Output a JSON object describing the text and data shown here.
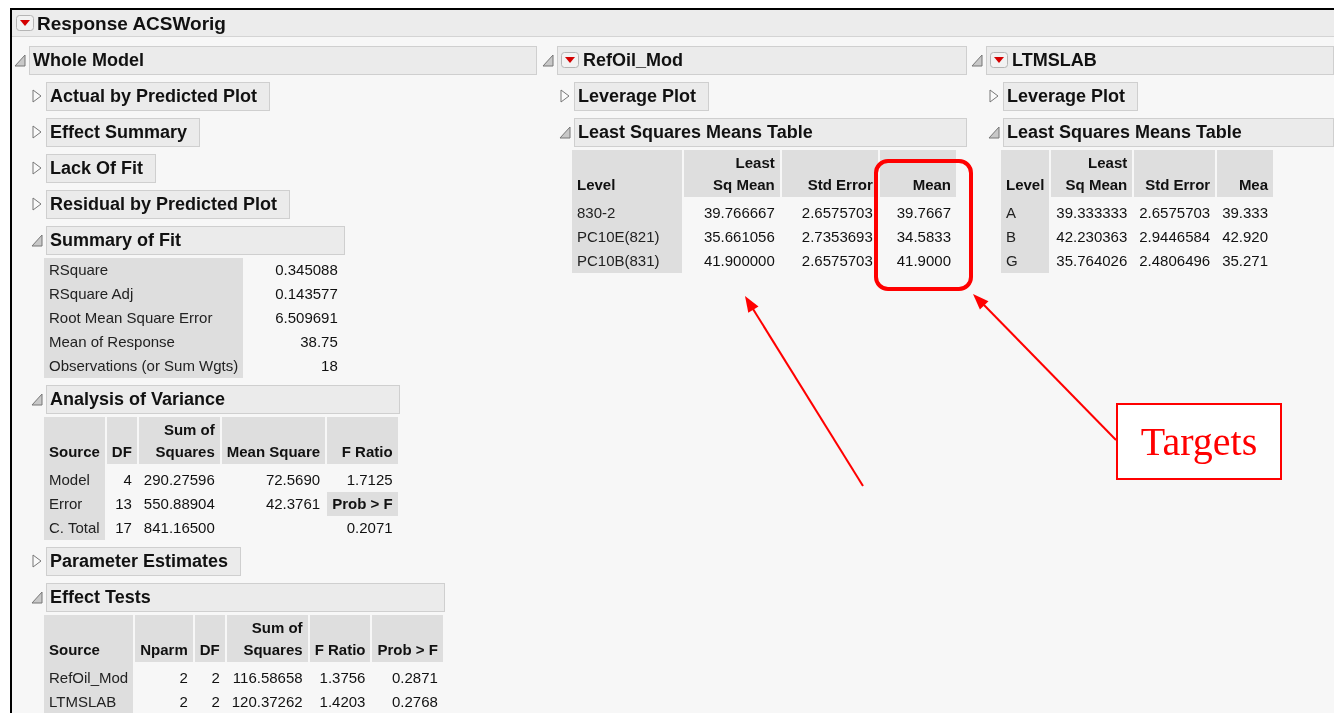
{
  "report": {
    "title": "Response ACSWorig",
    "has_menu": true
  },
  "columns": [
    {
      "title": "Whole Model",
      "expanded": true,
      "has_menu": false,
      "sections": [
        {
          "title": "Actual by Predicted Plot",
          "expanded": false
        },
        {
          "title": "Effect Summary",
          "expanded": false
        },
        {
          "title": "Lack Of Fit",
          "expanded": false
        },
        {
          "title": "Residual by Predicted Plot",
          "expanded": false
        },
        {
          "title": "Summary of Fit",
          "expanded": true,
          "table": {
            "kind": "pairs",
            "rows": [
              [
                "RSquare",
                "0.345088"
              ],
              [
                "RSquare Adj",
                "0.143577"
              ],
              [
                "Root Mean Square Error",
                "6.509691"
              ],
              [
                "Mean of Response",
                "38.75"
              ],
              [
                "Observations (or Sum Wgts)",
                "18"
              ]
            ]
          }
        },
        {
          "title": "Analysis of Variance",
          "expanded": true,
          "table": {
            "kind": "grid",
            "columns": [
              "Source",
              "DF",
              "Sum of\nSquares",
              "Mean Square",
              "F Ratio"
            ],
            "rows": [
              [
                "Model",
                "4",
                "290.27596",
                "72.5690",
                "1.7125"
              ],
              [
                "Error",
                "13",
                "550.88904",
                "42.3761",
                {
                  "text": "Prob > F",
                  "kind": "label"
                }
              ],
              [
                "C. Total",
                "17",
                "841.16500",
                null,
                "0.2071"
              ]
            ]
          }
        },
        {
          "title": "Parameter Estimates",
          "expanded": false
        },
        {
          "title": "Effect Tests",
          "expanded": true,
          "table": {
            "kind": "grid",
            "columns": [
              "Source",
              "Nparm",
              "DF",
              "Sum of\nSquares",
              "F Ratio",
              "Prob > F"
            ],
            "rows": [
              [
                "RefOil_Mod",
                "2",
                "2",
                "116.58658",
                "1.3756",
                "0.2871"
              ],
              [
                "LTMSLAB",
                "2",
                "2",
                "120.37262",
                "1.4203",
                "0.2768"
              ]
            ]
          }
        }
      ]
    },
    {
      "title": "RefOil_Mod",
      "expanded": true,
      "has_menu": true,
      "sections": [
        {
          "title": "Leverage Plot",
          "expanded": false
        },
        {
          "title": "Least Squares Means Table",
          "expanded": true,
          "table": {
            "kind": "grid",
            "columns": [
              "Level",
              "Least\nSq Mean",
              "Std Error",
              "Mean"
            ],
            "rows": [
              [
                "830-2",
                "39.766667",
                "2.6575703",
                "39.7667"
              ],
              [
                "PC10E(821)",
                "35.661056",
                "2.7353693",
                "34.5833"
              ],
              [
                "PC10B(831)",
                "41.900000",
                "2.6575703",
                "41.9000"
              ]
            ]
          }
        }
      ]
    },
    {
      "title": "LTMSLAB",
      "expanded": true,
      "has_menu": true,
      "sections": [
        {
          "title": "Leverage Plot",
          "expanded": false
        },
        {
          "title": "Least Squares Means Table",
          "expanded": true,
          "table": {
            "kind": "grid",
            "columns": [
              "Level",
              "Least\nSq Mean",
              "Std Error",
              "Mea"
            ],
            "rows": [
              [
                "A",
                "39.333333",
                "2.6575703",
                "39.333"
              ],
              [
                "B",
                "42.230363",
                "2.9446584",
                "42.920"
              ],
              [
                "G",
                "35.764026",
                "2.4806496",
                "35.271"
              ]
            ]
          }
        }
      ]
    }
  ],
  "callout": {
    "label": "Targets"
  }
}
